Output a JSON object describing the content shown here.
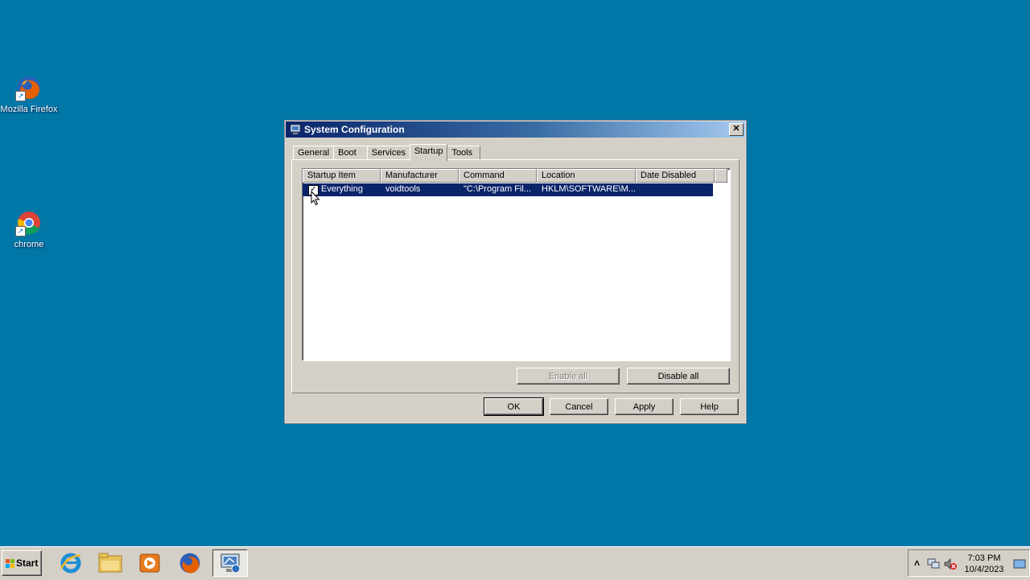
{
  "desktop": {
    "icons": [
      {
        "label": "Mozilla Firefox",
        "icon": "firefox-icon"
      },
      {
        "label": "chrome",
        "icon": "chrome-icon"
      }
    ]
  },
  "window": {
    "title": "System Configuration",
    "close_glyph": "✕",
    "tabs": [
      "General",
      "Boot",
      "Services",
      "Startup",
      "Tools"
    ],
    "active_tab": "Startup",
    "columns": [
      "Startup Item",
      "Manufacturer",
      "Command",
      "Location",
      "Date Disabled"
    ],
    "rows": [
      {
        "checked": true,
        "startup_item": "Everything",
        "manufacturer": "voidtools",
        "command": "\"C:\\Program Fil...",
        "location": "HKLM\\SOFTWARE\\M...",
        "date_disabled": ""
      }
    ],
    "buttons": {
      "enable_all": "Enable all",
      "disable_all": "Disable all",
      "ok": "OK",
      "cancel": "Cancel",
      "apply": "Apply",
      "help": "Help"
    }
  },
  "taskbar": {
    "start_label": "Start",
    "apps": [
      "internet-explorer-icon",
      "file-explorer-icon",
      "media-player-icon",
      "firefox-icon",
      "system-configuration-icon"
    ],
    "tray_expand": "˄",
    "clock_time": "7:03 PM",
    "clock_date": "10/4/2023"
  },
  "colors": {
    "desktop": "#0077a6",
    "title_gradient_start": "#0a246a",
    "title_gradient_end": "#a6caf0",
    "selection": "#0a246a"
  }
}
